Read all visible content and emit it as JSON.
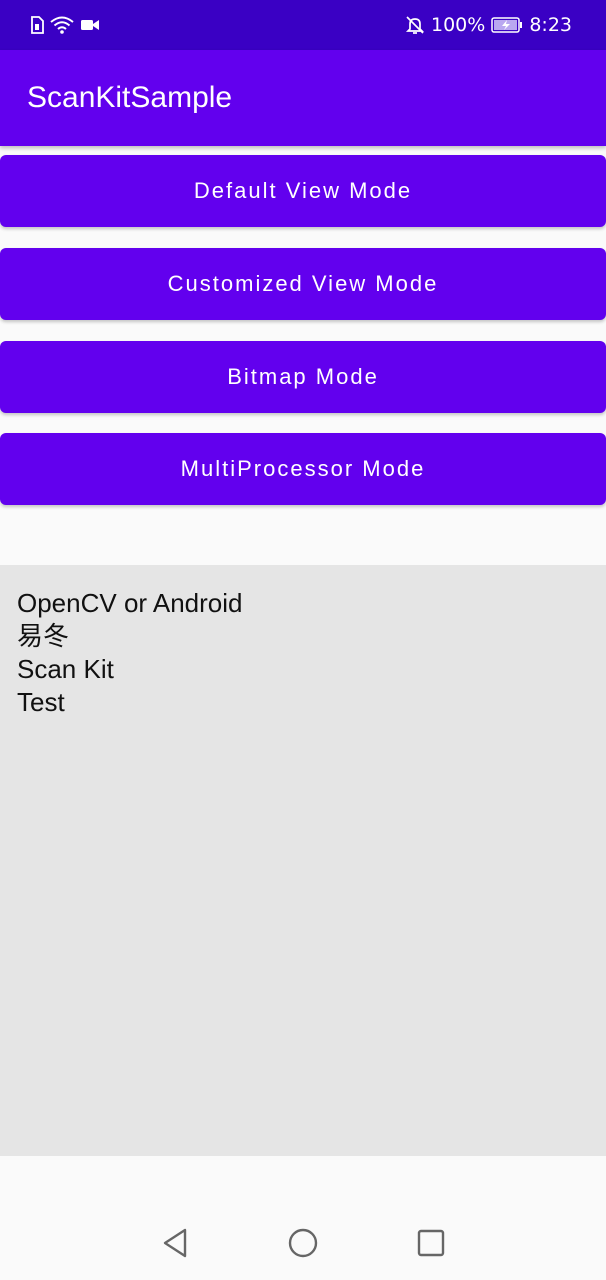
{
  "status_bar": {
    "battery_percent": "100%",
    "time": "8:23",
    "icons_left": [
      "sim-card-icon",
      "wifi-icon",
      "video-camera-icon"
    ],
    "icons_right": [
      "bell-off-icon",
      "battery-charging-icon"
    ]
  },
  "app_bar": {
    "title": "ScanKitSample"
  },
  "buttons": [
    {
      "label": "Default View Mode"
    },
    {
      "label": "Customized View Mode"
    },
    {
      "label": "Bitmap Mode"
    },
    {
      "label": "MultiProcessor Mode"
    }
  ],
  "output": {
    "lines": [
      "OpenCV or Android",
      "易冬",
      "Scan Kit",
      "Test"
    ]
  },
  "nav_bar": {
    "icons": [
      "back-icon",
      "home-icon",
      "recents-icon"
    ]
  },
  "colors": {
    "status_bar": "#3a00c4",
    "primary": "#6200ee",
    "panel": "#e5e5e5",
    "background": "#fafafa"
  }
}
